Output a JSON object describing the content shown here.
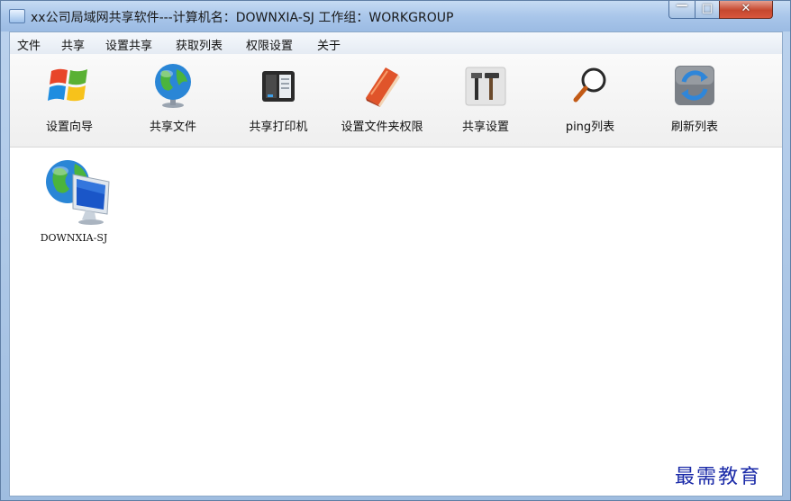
{
  "window": {
    "title": "xx公司局域网共享软件---计算机名：DOWNXIA-SJ  工作组：WORKGROUP",
    "min_glyph": "—",
    "max_glyph": "□",
    "close_glyph": "✕"
  },
  "menu": {
    "items": [
      "文件",
      "共享",
      "设置共享",
      "获取列表",
      "权限设置",
      "关于"
    ]
  },
  "toolbar": {
    "items": [
      {
        "label": "设置向导",
        "icon": "windows-logo-icon"
      },
      {
        "label": "共享文件",
        "icon": "globe-icon"
      },
      {
        "label": "共享打印机",
        "icon": "printer-icon"
      },
      {
        "label": "设置文件夹权限",
        "icon": "book-icon"
      },
      {
        "label": "共享设置",
        "icon": "tools-icon"
      },
      {
        "label": "ping列表",
        "icon": "magnifier-icon"
      },
      {
        "label": "刷新列表",
        "icon": "refresh-icon"
      }
    ]
  },
  "content": {
    "computers": [
      {
        "name": "DOWNXIA-SJ",
        "icon": "network-computer-icon"
      }
    ]
  },
  "watermark": "最需教育",
  "colors": {
    "title_bar": "#a9c6ea",
    "close_button": "#c6472e",
    "watermark": "#1a2aa8"
  }
}
